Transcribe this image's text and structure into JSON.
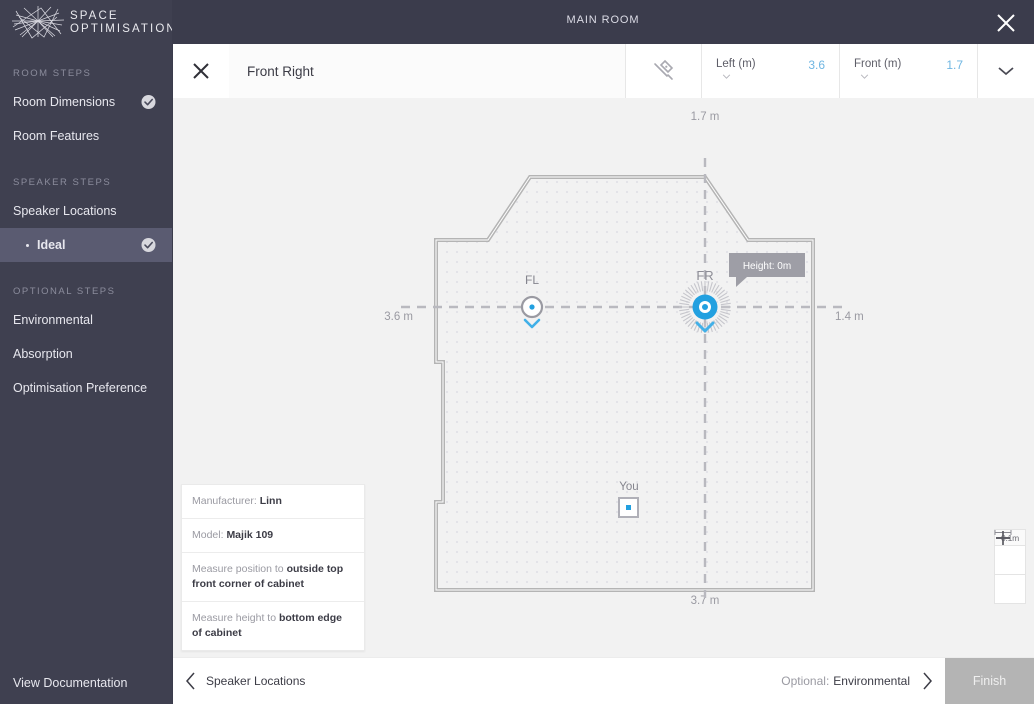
{
  "brand": {
    "line1": "SPACE",
    "line2": "OPTIMISATION",
    "logo_icon": "starburst-logo-icon"
  },
  "header": {
    "title": "MAIN ROOM",
    "close_icon": "close-icon"
  },
  "sidebar": {
    "sections": [
      {
        "title": "ROOM STEPS",
        "items": [
          {
            "label": "Room Dimensions",
            "complete": true,
            "active": false,
            "sub": false
          },
          {
            "label": "Room Features",
            "complete": false,
            "active": false,
            "sub": false
          }
        ]
      },
      {
        "title": "SPEAKER STEPS",
        "items": [
          {
            "label": "Speaker Locations",
            "complete": false,
            "active": false,
            "sub": false
          },
          {
            "label": "Ideal",
            "complete": true,
            "active": true,
            "sub": true
          }
        ]
      },
      {
        "title": "OPTIONAL STEPS",
        "items": [
          {
            "label": "Environmental",
            "complete": false,
            "active": false,
            "sub": false
          },
          {
            "label": "Absorption",
            "complete": false,
            "active": false,
            "sub": false
          },
          {
            "label": "Optimisation Preference",
            "complete": false,
            "active": false,
            "sub": false
          }
        ]
      }
    ],
    "documentation_label": "View Documentation"
  },
  "toolbar": {
    "close_icon": "close-icon",
    "speaker_name": "Front Right",
    "measure_icon": "measure-tool-icon",
    "fields": [
      {
        "label": "Left (m)",
        "value": "3.6",
        "caret_icon": "chevron-down-icon"
      },
      {
        "label": "Front (m)",
        "value": "1.7",
        "caret_icon": "chevron-down-icon"
      }
    ],
    "expand_icon": "chevron-down-icon"
  },
  "plan": {
    "dimensions": {
      "top": "1.7 m",
      "left": "3.6 m",
      "right": "1.4 m",
      "bottom": "3.7 m"
    },
    "speakers": [
      {
        "id": "FL",
        "label": "FL",
        "selected": false
      },
      {
        "id": "FR",
        "label": "FR",
        "selected": true
      }
    ],
    "listener_label": "You",
    "height_tooltip": "Height: 0m",
    "accent_color": "#22a0e0",
    "wall_color": "#b4b4b4",
    "floor_color": "#ffffff"
  },
  "info_card": {
    "rows": [
      {
        "prefix": "Manufacturer: ",
        "value": "Linn"
      },
      {
        "prefix": "Model: ",
        "value": "Majik 109"
      },
      {
        "prefix": "Measure position to ",
        "value": "outside top front corner of cabinet"
      },
      {
        "prefix": "Measure height to ",
        "value": "bottom edge of cabinet"
      }
    ]
  },
  "zoom_widget": {
    "scale_label": "0.1m",
    "zoom_in_icon": "plus-icon",
    "zoom_out_icon": "minus-icon",
    "scale_bar_icon": "scale-bar-icon"
  },
  "footer": {
    "prev_icon": "chevron-left-icon",
    "prev_label": "Speaker Locations",
    "next_optional_prefix": "Optional:",
    "next_label": "Environmental",
    "next_icon": "chevron-right-icon",
    "finish_label": "Finish"
  }
}
